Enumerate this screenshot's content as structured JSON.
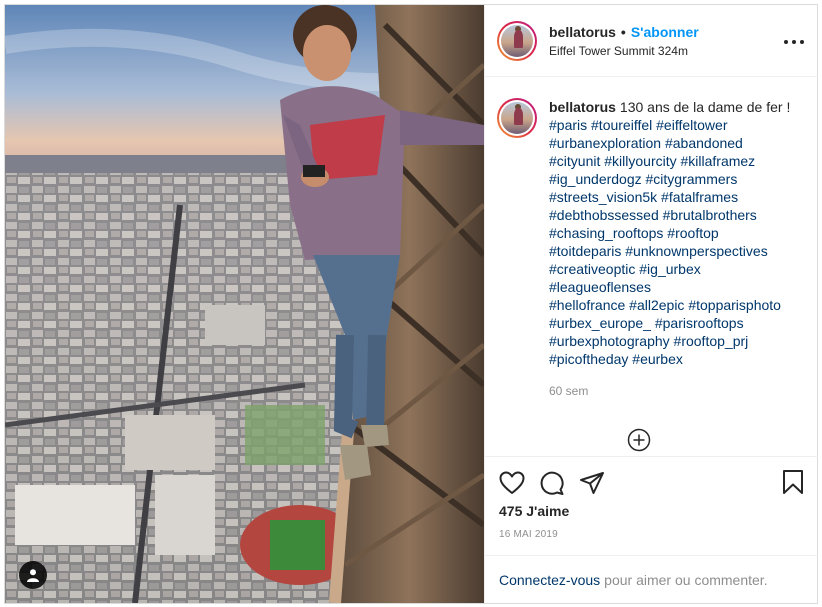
{
  "post": {
    "username": "bellatorus",
    "separator": "•",
    "follow_label": "S'abonner",
    "location": "Eiffel Tower Summit 324m",
    "caption": {
      "username": "bellatorus",
      "text": "130 ans de la dame de fer !",
      "hashtag_lines": [
        "#paris #toureiffel #eiffeltower",
        "#urbanexploration #abandoned",
        "#cityunit #killyourcity #killaframez",
        "#ig_underdogz #citygrammers",
        "#streets_vision5k #fatalframes",
        "#debthobssessed #brutalbrothers",
        "#chasing_rooftops #rooftop",
        "#toitdeparis #unknownperspectives",
        "#creativeoptic #ig_urbex",
        "#leagueoflenses",
        "#hellofrance #all2epic #topparisphoto",
        "#urbex_europe_ #parisrooftops",
        "#urbexphotography #rooftop_prj",
        "#picoftheday #eurbex"
      ]
    },
    "time_ago": "60 sem",
    "likes": "475 J'aime",
    "date": "16 MAI 2019",
    "comment_prompt": {
      "link": "Connectez-vous",
      "text": "pour aimer ou commenter."
    }
  },
  "icons": {
    "more": "more-options-icon",
    "load_more": "plus-circle-icon",
    "like": "heart-icon",
    "comment": "comment-icon",
    "share": "paper-plane-icon",
    "save": "bookmark-icon",
    "user_tag": "user-tag-icon"
  },
  "colors": {
    "accent": "#0095f6",
    "link": "#00376b",
    "secondary": "#8e8e8e",
    "border": "#dbdbdb"
  }
}
